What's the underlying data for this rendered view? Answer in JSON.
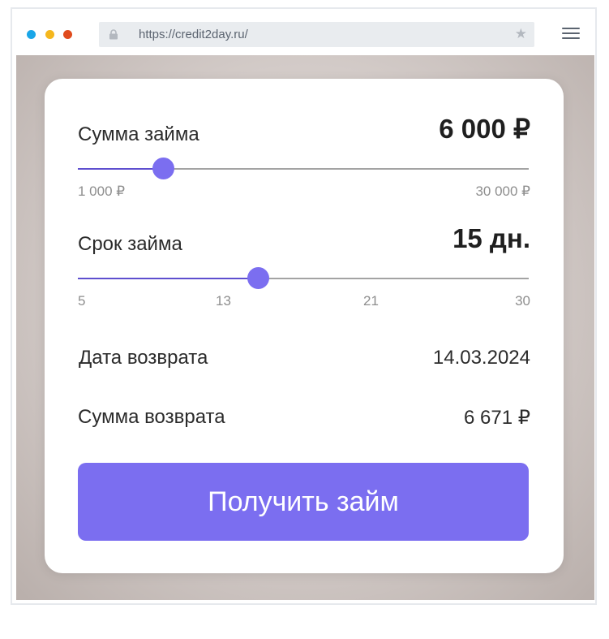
{
  "browser": {
    "url": "https://credit2day.ru/",
    "traffic_lights": [
      "#1aa6e8",
      "#f5b71d",
      "#e04b1d"
    ]
  },
  "calculator": {
    "amount": {
      "label": "Сумма займа",
      "value_text": "6 000 ₽",
      "min_label": "1 000 ₽",
      "max_label": "30 000 ₽",
      "min": 1000,
      "max": 30000,
      "value": 6000
    },
    "term": {
      "label": "Срок займа",
      "value_text": "15 дн.",
      "ticks": [
        "5",
        "13",
        "21",
        "30"
      ],
      "min": 5,
      "max": 30,
      "value": 15
    },
    "return_date": {
      "label": "Дата возврата",
      "value": "14.03.2024"
    },
    "return_sum": {
      "label": "Сумма возврата",
      "value": "6 671 ₽"
    },
    "cta_label": "Получить займ"
  },
  "colors": {
    "accent": "#7b6ef0",
    "track_fill": "#5e4fcf"
  }
}
